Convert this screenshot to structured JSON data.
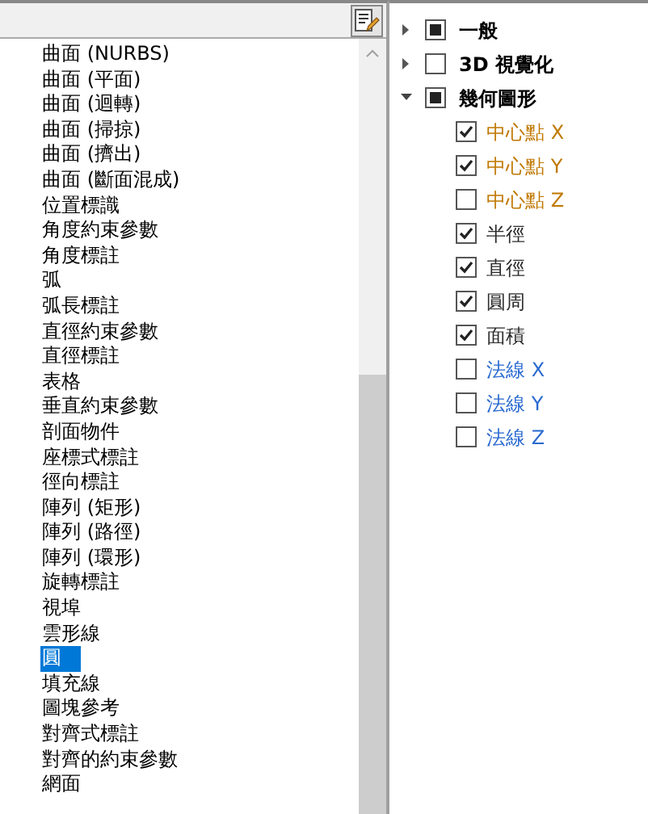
{
  "list": {
    "items": [
      {
        "label": "曲面 (NURBS)",
        "selected": false
      },
      {
        "label": "曲面 (平面)",
        "selected": false
      },
      {
        "label": "曲面 (迴轉)",
        "selected": false
      },
      {
        "label": "曲面 (掃掠)",
        "selected": false
      },
      {
        "label": "曲面 (擠出)",
        "selected": false
      },
      {
        "label": "曲面 (斷面混成)",
        "selected": false
      },
      {
        "label": "位置標識",
        "selected": false
      },
      {
        "label": "角度約束參數",
        "selected": false
      },
      {
        "label": "角度標註",
        "selected": false
      },
      {
        "label": "弧",
        "selected": false
      },
      {
        "label": "弧長標註",
        "selected": false
      },
      {
        "label": "直徑約束參數",
        "selected": false
      },
      {
        "label": "直徑標註",
        "selected": false
      },
      {
        "label": "表格",
        "selected": false
      },
      {
        "label": "垂直約束參數",
        "selected": false
      },
      {
        "label": "剖面物件",
        "selected": false
      },
      {
        "label": "座標式標註",
        "selected": false
      },
      {
        "label": "徑向標註",
        "selected": false
      },
      {
        "label": "陣列 (矩形)",
        "selected": false
      },
      {
        "label": "陣列 (路徑)",
        "selected": false
      },
      {
        "label": "陣列 (環形)",
        "selected": false
      },
      {
        "label": "旋轉標註",
        "selected": false
      },
      {
        "label": "視埠",
        "selected": false
      },
      {
        "label": "雲形線",
        "selected": false
      },
      {
        "label": "圓",
        "selected": true
      },
      {
        "label": "填充線",
        "selected": false
      },
      {
        "label": "圖塊參考",
        "selected": false
      },
      {
        "label": "對齊式標註",
        "selected": false
      },
      {
        "label": "對齊的約束參數",
        "selected": false
      },
      {
        "label": "網面",
        "selected": false
      }
    ]
  },
  "tree": [
    {
      "label": "一般",
      "expanded": false,
      "partial": true
    },
    {
      "label": "3D 視覺化",
      "expanded": false,
      "partial": false
    },
    {
      "label": "幾何圖形",
      "expanded": true,
      "partial": true,
      "children": [
        {
          "label": "中心點 X",
          "checked": true,
          "color": "#c07800"
        },
        {
          "label": "中心點 Y",
          "checked": true,
          "color": "#c07800"
        },
        {
          "label": "中心點 Z",
          "checked": false,
          "color": "#c07800"
        },
        {
          "label": "半徑",
          "checked": true,
          "color": "#2a2a2a"
        },
        {
          "label": "直徑",
          "checked": true,
          "color": "#2a2a2a"
        },
        {
          "label": "圓周",
          "checked": true,
          "color": "#2a2a2a"
        },
        {
          "label": "面積",
          "checked": true,
          "color": "#2a2a2a"
        },
        {
          "label": "法線 X",
          "checked": false,
          "color": "#2a6ad0"
        },
        {
          "label": "法線 Y",
          "checked": false,
          "color": "#2a6ad0"
        },
        {
          "label": "法線 Z",
          "checked": false,
          "color": "#2a6ad0"
        }
      ]
    }
  ]
}
